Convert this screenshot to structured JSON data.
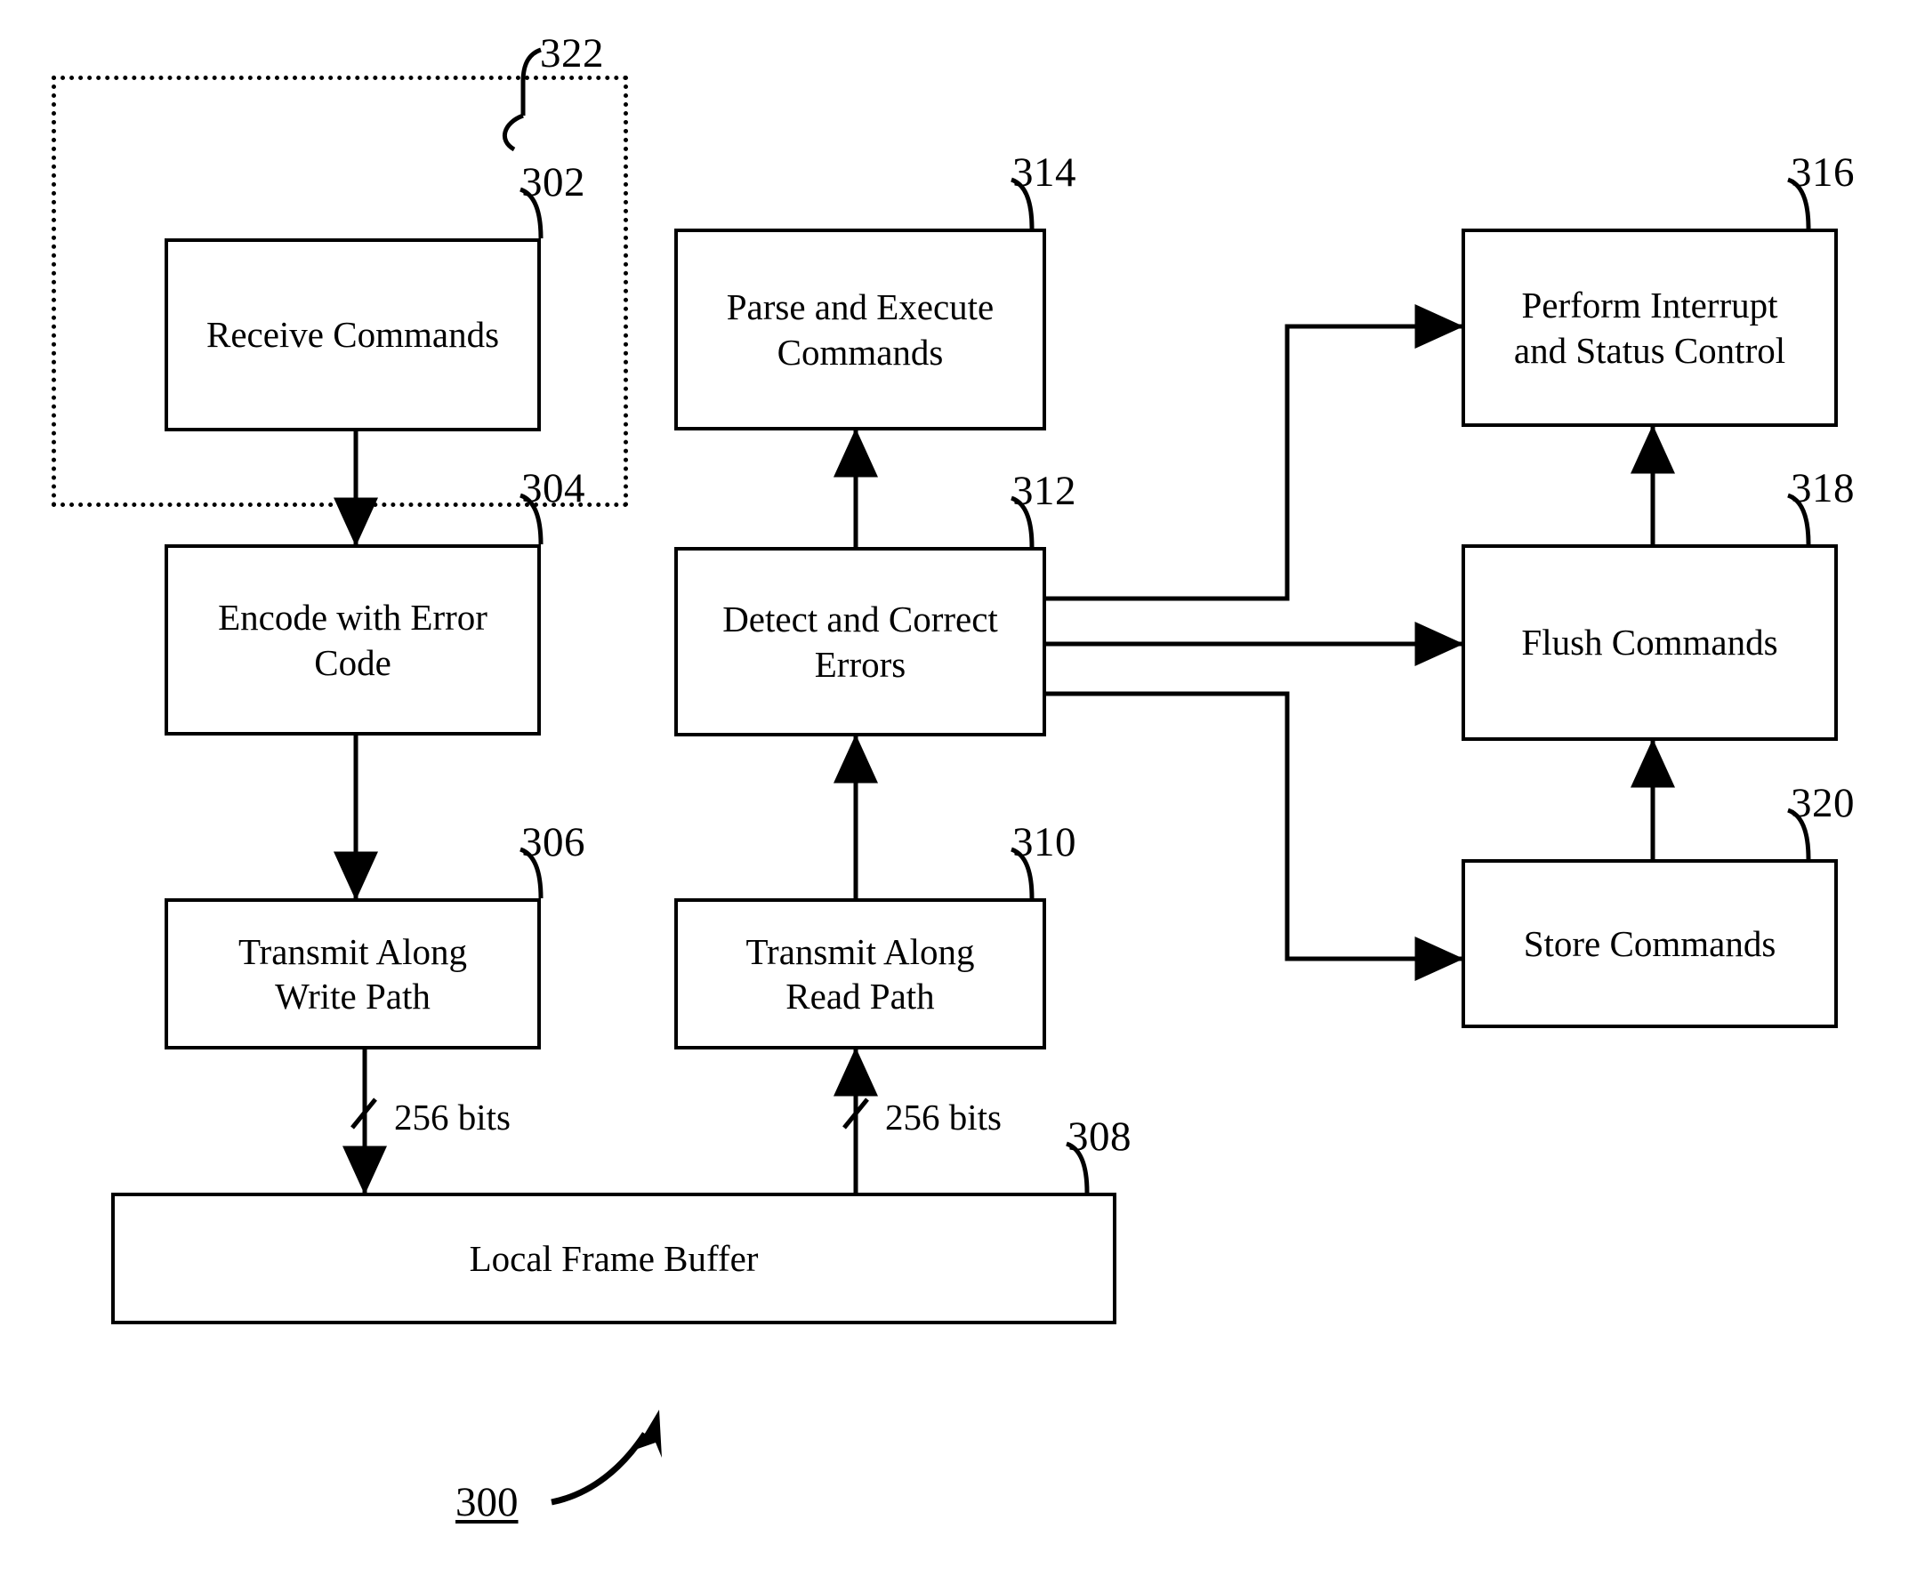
{
  "figure": {
    "tag": "300",
    "title_label": "300"
  },
  "regions": [
    {
      "id": "322",
      "ref": "322",
      "name": "write-encode-region"
    }
  ],
  "nodes": [
    {
      "id": "302",
      "ref": "302",
      "label": "Receive Commands",
      "name": "receive-commands"
    },
    {
      "id": "304",
      "ref": "304",
      "label": "Encode with Error\nCode",
      "name": "encode-with-error-code"
    },
    {
      "id": "306",
      "ref": "306",
      "label": "Transmit Along\nWrite Path",
      "name": "transmit-along-write-path"
    },
    {
      "id": "308",
      "ref": "308",
      "label": "Local Frame Buffer",
      "name": "local-frame-buffer"
    },
    {
      "id": "310",
      "ref": "310",
      "label": "Transmit Along\nRead Path",
      "name": "transmit-along-read-path"
    },
    {
      "id": "312",
      "ref": "312",
      "label": "Detect and Correct\nErrors",
      "name": "detect-and-correct-errors"
    },
    {
      "id": "314",
      "ref": "314",
      "label": "Parse and Execute\nCommands",
      "name": "parse-and-execute-commands"
    },
    {
      "id": "316",
      "ref": "316",
      "label": "Perform Interrupt\nand Status Control",
      "name": "perform-interrupt-and-status-control"
    },
    {
      "id": "318",
      "ref": "318",
      "label": "Flush Commands",
      "name": "flush-commands"
    },
    {
      "id": "320",
      "ref": "320",
      "label": "Store Commands",
      "name": "store-commands"
    }
  ],
  "edge_labels": [
    {
      "id": "write-bus",
      "text": "256 bits"
    },
    {
      "id": "read-bus",
      "text": "256 bits"
    }
  ],
  "colors": {
    "stroke": "#000000",
    "background": "#ffffff"
  }
}
